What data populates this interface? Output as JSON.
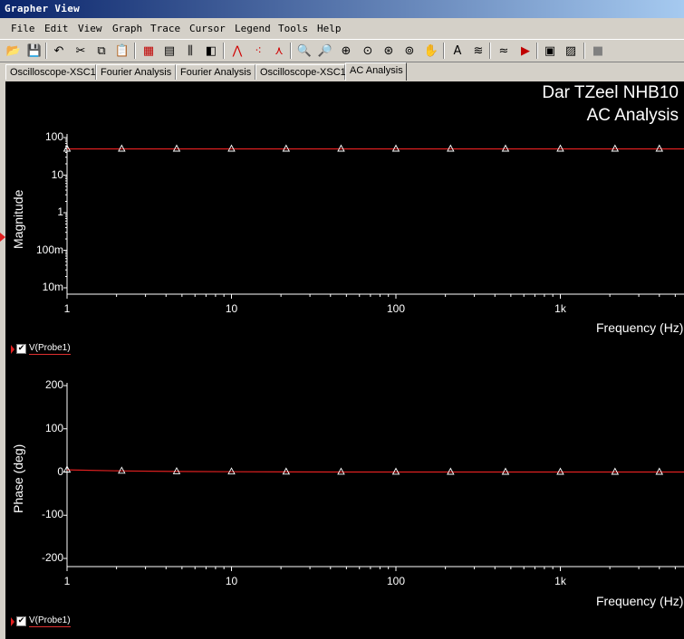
{
  "window": {
    "title": "Grapher View"
  },
  "menu": [
    "File",
    "Edit",
    "View",
    "Graph",
    "Trace",
    "Cursor",
    "Legend",
    "Tools",
    "Help"
  ],
  "toolbar": [
    {
      "icon": "open-icon",
      "glyph": "📂"
    },
    {
      "icon": "save-icon",
      "glyph": "💾"
    },
    {
      "icon": "undo-icon",
      "glyph": "↶"
    },
    {
      "icon": "cut-icon",
      "glyph": "✂"
    },
    {
      "icon": "copy-icon",
      "glyph": "⧉"
    },
    {
      "icon": "paste-icon",
      "glyph": "📋"
    },
    {
      "icon": "grid-icon",
      "glyph": "▦"
    },
    {
      "icon": "legend-icon",
      "glyph": "▤"
    },
    {
      "icon": "cursors-icon",
      "glyph": "⫼"
    },
    {
      "icon": "reverse-colors-icon",
      "glyph": "◧"
    },
    {
      "icon": "show-lines-icon",
      "glyph": "⋀"
    },
    {
      "icon": "show-points-icon",
      "glyph": "⁖"
    },
    {
      "icon": "show-lines-points-icon",
      "glyph": "⋏"
    },
    {
      "icon": "zoom-in-icon",
      "glyph": "🔍"
    },
    {
      "icon": "zoom-out-icon",
      "glyph": "🔎"
    },
    {
      "icon": "zoom-full-icon",
      "glyph": "⊕"
    },
    {
      "icon": "zoom-select-icon",
      "glyph": "⊙"
    },
    {
      "icon": "zoom-x-icon",
      "glyph": "⊛"
    },
    {
      "icon": "zoom-y-icon",
      "glyph": "⊚"
    },
    {
      "icon": "pan-icon",
      "glyph": "✋"
    },
    {
      "icon": "text-icon",
      "glyph": "A"
    },
    {
      "icon": "overlay-icon",
      "glyph": "≋"
    },
    {
      "icon": "add-trace-icon",
      "glyph": "≈"
    },
    {
      "icon": "export-icon",
      "glyph": "▶"
    },
    {
      "icon": "print-icon",
      "glyph": "▣"
    },
    {
      "icon": "print-preview-icon",
      "glyph": "▨"
    },
    {
      "icon": "stop-icon",
      "glyph": "■"
    }
  ],
  "tabs": [
    {
      "label": "Oscilloscope-XSC1",
      "active": false
    },
    {
      "label": "Fourier Analysis",
      "active": false
    },
    {
      "label": "Fourier Analysis",
      "active": false
    },
    {
      "label": "Oscilloscope-XSC1",
      "active": false
    },
    {
      "label": "AC Analysis",
      "active": true
    }
  ],
  "plot": {
    "title_line1": "Dar TZeel NHB10",
    "title_line2": "AC Analysis",
    "colors": {
      "background": "#000000",
      "trace": "#e02020",
      "grid_text": "#ffffff"
    }
  },
  "chart_data": [
    {
      "type": "line",
      "ylabel": "Magnitude",
      "xlabel": "Frequency (Hz)",
      "xscale": "log",
      "yscale": "log",
      "y_ticks": [
        "100",
        "10",
        "1",
        "100m",
        "10m"
      ],
      "x_ticks": [
        "1",
        "10",
        "100",
        "1k"
      ],
      "xlim": [
        1,
        4000
      ],
      "ylim": [
        0.007,
        120
      ],
      "series": [
        {
          "name": "V(Probe1)",
          "x": [
            1,
            2.15,
            4.64,
            10,
            21.5,
            46.4,
            100,
            215,
            464,
            1000,
            2150,
            4000
          ],
          "y": [
            50,
            50,
            50,
            50,
            50,
            50,
            50,
            50,
            50,
            50,
            50,
            50
          ]
        }
      ],
      "legend": "bottom-left"
    },
    {
      "type": "line",
      "ylabel": "Phase (deg)",
      "xlabel": "Frequency (Hz)",
      "xscale": "log",
      "y_ticks": [
        "200",
        "100",
        "0",
        "-100",
        "-200"
      ],
      "x_ticks": [
        "1",
        "10",
        "100",
        "1k"
      ],
      "xlim": [
        1,
        4000
      ],
      "ylim": [
        -210,
        210
      ],
      "series": [
        {
          "name": "V(Probe1)",
          "x": [
            1,
            2.15,
            4.64,
            10,
            21.5,
            46.4,
            100,
            215,
            464,
            1000,
            2150,
            4000
          ],
          "y": [
            5,
            2.5,
            1.2,
            0.6,
            0.3,
            0.1,
            0.05,
            0,
            0,
            0,
            0,
            0
          ]
        }
      ],
      "legend": "bottom-left"
    }
  ]
}
